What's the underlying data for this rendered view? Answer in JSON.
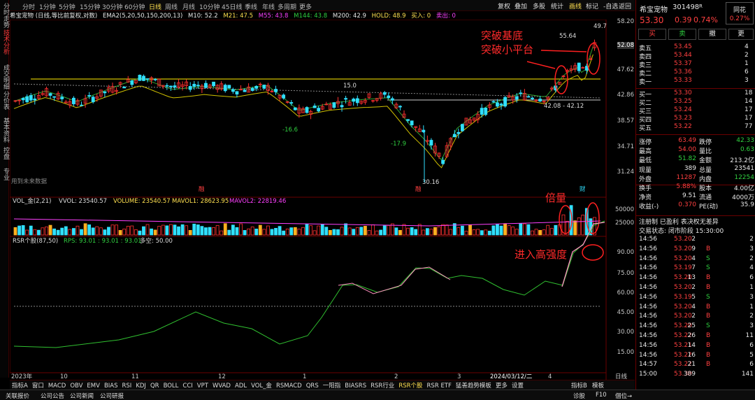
{
  "sidebar": {
    "tabs": [
      {
        "label": "分时走势",
        "active": false
      },
      {
        "label": "技术分析",
        "active": true
      },
      {
        "label": "成交明细",
        "active": false
      },
      {
        "label": "分价表",
        "active": false
      },
      {
        "label": "基本资料",
        "active": false
      },
      {
        "label": "控盘",
        "active": false
      },
      {
        "label": "专业",
        "active": false
      }
    ]
  },
  "toolbar": {
    "timeframes": [
      "分时",
      "1分钟",
      "5分钟",
      "15分钟",
      "30分钟",
      "60分钟",
      "日线",
      "周线",
      "月线",
      "10分钟",
      "45日线",
      "季线",
      "年线",
      "多周期",
      "更多"
    ],
    "active_timeframe": "日线",
    "right_buttons": [
      "复权",
      "叠加",
      "多股",
      "统计",
      "画线",
      "标记",
      "-自选",
      "返回"
    ]
  },
  "infobar": {
    "stock": "希宝宠物 (日线,等比前复权,对数)",
    "ema_label": "EMA2(5,20,50,150,200,13)",
    "m10": "M10: 52.2",
    "m21": "M21: 47.5",
    "m55": "M55: 43.8",
    "m144": "M144: 43.8",
    "m200": "M200: 42.9",
    "hold": "HOLD: 48.9",
    "buy": "买入: 0",
    "sell": "卖出: 0"
  },
  "price_axis": [
    "58.20",
    "52.08",
    "47.62",
    "42.86",
    "38.57",
    "34.71",
    "31.24"
  ],
  "chart_labels": {
    "high": "49.7",
    "hi2": "55.64",
    "l150": "15.0",
    "ln166": "-16.6",
    "ln179": "-17.9",
    "low": "30.16",
    "range": "42.08 - 42.12",
    "future": "用到未来数据",
    "markers": [
      "融",
      "融",
      "财"
    ]
  },
  "vol_info": {
    "title": "VOL_金(2,21)",
    "vvol": "VVOL: 23540.57",
    "volume": "VOLUME: 23540.57",
    "mavol1": "MAVOL1: 28623.95",
    "mavol2": "MAVOL2: 22819.46"
  },
  "vol_axis": [
    "50000",
    "25000"
  ],
  "rsr_info": {
    "title": "RSR个股(87,50)",
    "rps": "RPS: 93.01 : 93.01 : 93.01",
    "dk": "多空: 50.00"
  },
  "rsr_axis": [
    "90.00",
    "75.00",
    "60.00",
    "45.00",
    "30.00",
    "15.00"
  ],
  "date_axis": [
    "2023年",
    "10",
    "11",
    "12",
    "1",
    "2",
    "3",
    "2024/03/12/二",
    "4"
  ],
  "date_axis_right": "日线",
  "annotations": {
    "a1": "突破基底",
    "a2": "突破小平台",
    "a3": "倍量",
    "a4": "进入高强度"
  },
  "bottom_tabs": [
    "指标A",
    "窗口",
    "MACD",
    "OBV",
    "EMV",
    "BIAS",
    "RSI",
    "KDJ",
    "QR",
    "BOLL",
    "CCI",
    "VPT",
    "WVAD",
    "ADL",
    "VOL_金",
    "RSMACD",
    "QRS",
    "一阳指",
    "BIASRS",
    "RSR行业",
    "RSR个股",
    "RSR ETF",
    "猛善趋势模板",
    "更多",
    "设置"
  ],
  "bottom_active": "RSR个股",
  "bottom_right": [
    "指标B",
    "模板"
  ],
  "statusbar": {
    "left": [
      "关联报价",
      "公司公告",
      "公司新闻",
      "公司研报"
    ],
    "right": [
      "诊股",
      "F10",
      "個位→"
    ]
  },
  "quote": {
    "name": "希宝宠物",
    "code": "301498",
    "suffix": "R",
    "tag": "同花",
    "tag_pct": "0.27%",
    "price": "53.30",
    "change": "0.39",
    "pct": "0.74%",
    "buy_btn": "买",
    "sell_btn": "卖",
    "cancel_btn": "撤",
    "more_btn": "更",
    "asks": [
      {
        "l": "卖五",
        "p": "53.45",
        "v": "4"
      },
      {
        "l": "卖四",
        "p": "53.44",
        "v": "2"
      },
      {
        "l": "卖三",
        "p": "53.37",
        "v": "1"
      },
      {
        "l": "卖二",
        "p": "53.36",
        "v": "6"
      },
      {
        "l": "卖一",
        "p": "53.33",
        "v": "3"
      }
    ],
    "bids": [
      {
        "l": "买一",
        "p": "53.30",
        "v": "18"
      },
      {
        "l": "买二",
        "p": "53.25",
        "v": "14"
      },
      {
        "l": "买三",
        "p": "53.24",
        "v": "17"
      },
      {
        "l": "买四",
        "p": "53.23",
        "v": "17"
      },
      {
        "l": "买五",
        "p": "53.22",
        "v": "77"
      }
    ],
    "stats": [
      [
        "涨停",
        "63.49",
        "跌停",
        "42.33"
      ],
      [
        "最高",
        "54.00",
        "量比",
        "0.63"
      ],
      [
        "最低",
        "51.82",
        "金额",
        "213.2亿"
      ],
      [
        "现量",
        "389",
        "总量",
        "23541"
      ],
      [
        "外盘",
        "11287",
        "内盘",
        "12254"
      ],
      [
        "换手",
        "5.88%",
        "股本",
        "4.00亿"
      ],
      [
        "净资",
        "9.51",
        "流通",
        "4000万"
      ],
      [
        "收益(-)",
        "0.370",
        "PE(动)",
        "35.9"
      ]
    ],
    "reg": "注册制 已盈利 表决权无差异",
    "status": "交易状态: 闭市阶段 15:30:00",
    "ticks": [
      [
        "14:56",
        "53.20",
        "2",
        "",
        "2"
      ],
      [
        "14:56",
        "53.20",
        "9",
        "B",
        "3"
      ],
      [
        "14:56",
        "53.20",
        "4",
        "S",
        "2"
      ],
      [
        "14:56",
        "53.19",
        "7",
        "S",
        "4"
      ],
      [
        "14:56",
        "53.20",
        "13",
        "B",
        "6"
      ],
      [
        "14:56",
        "53.20",
        "2",
        "B",
        "1"
      ],
      [
        "14:56",
        "53.19",
        "5",
        "S",
        "3"
      ],
      [
        "14:56",
        "53.20",
        "4",
        "B",
        "1"
      ],
      [
        "14:56",
        "53.20",
        "2",
        "B",
        "2"
      ],
      [
        "14:56",
        "53.20",
        "25",
        "S",
        "3"
      ],
      [
        "14:56",
        "53.22",
        "26",
        "B",
        "11"
      ],
      [
        "14:56",
        "53.21",
        "14",
        "B",
        "6"
      ],
      [
        "14:56",
        "53.22",
        "16",
        "B",
        "5"
      ],
      [
        "14:57",
        "53.22",
        "21",
        "B",
        "6"
      ],
      [
        "15:00",
        "53.30",
        "389",
        "",
        "141"
      ]
    ]
  }
}
